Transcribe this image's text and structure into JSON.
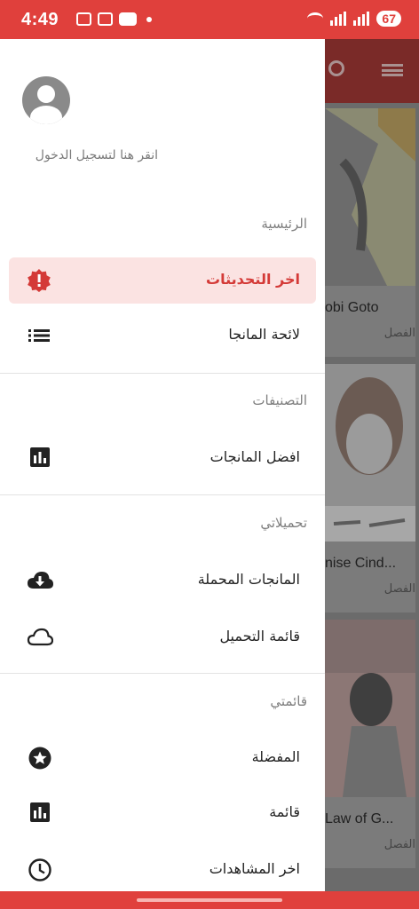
{
  "status_bar": {
    "time": "4:49",
    "battery": "67"
  },
  "drawer": {
    "login_text": "انقر هنا لتسجيل الدخول",
    "sections": {
      "main": "الرئيسية",
      "categories": "التصنيفات",
      "downloads": "تحميلاتي",
      "my_list": "قائمتي"
    },
    "items": {
      "latest_updates": "اخر التحديثات",
      "manga_list": "لائحة المانجا",
      "top_manga": "افضل المانجات",
      "downloaded_manga": "المانجات المحملة",
      "download_queue": "قائمة التحميل",
      "favorites": "المفضلة",
      "list": "قائمة",
      "watch_history": "اخر المشاهدات"
    }
  },
  "background": {
    "cards": [
      {
        "title": "obi Goto",
        "subtitle": "الفصل"
      },
      {
        "title": "nise Cind...",
        "subtitle": "الفصل"
      },
      {
        "title": "Law of G...",
        "subtitle": "الفصل"
      }
    ]
  },
  "colors": {
    "accent": "#e0403c",
    "active_bg": "#fbe3e2",
    "active_text": "#d43a37"
  }
}
